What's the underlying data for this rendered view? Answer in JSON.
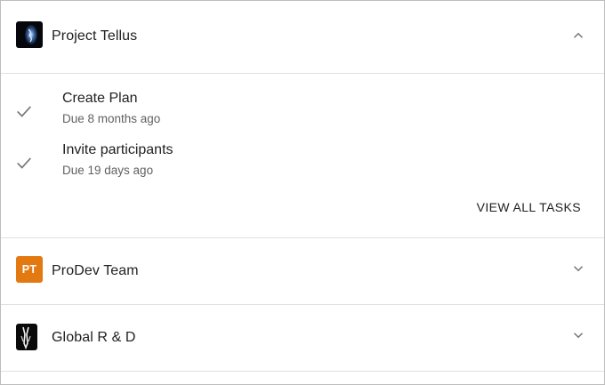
{
  "groups": [
    {
      "title": "Project Tellus",
      "avatar_kind": "image",
      "expanded": true,
      "chevron_icon": "chevron-up-icon",
      "tasks": [
        {
          "title": "Create Plan",
          "due": "Due 8 months ago",
          "icon": "check-icon"
        },
        {
          "title": "Invite participants",
          "due": "Due 19 days ago",
          "icon": "check-icon"
        }
      ],
      "view_all_label": "VIEW ALL TASKS"
    },
    {
      "title": "ProDev Team",
      "avatar_initials": "PT",
      "avatar_color": "#e37a11",
      "expanded": false,
      "chevron_icon": "chevron-down-icon"
    },
    {
      "title": "Global R & D",
      "avatar_kind": "image",
      "expanded": false,
      "chevron_icon": "chevron-down-icon"
    }
  ],
  "colors": {
    "divider": "#e0e0e0",
    "text_primary": "#212121",
    "text_secondary": "#616161",
    "icon": "#757575"
  }
}
